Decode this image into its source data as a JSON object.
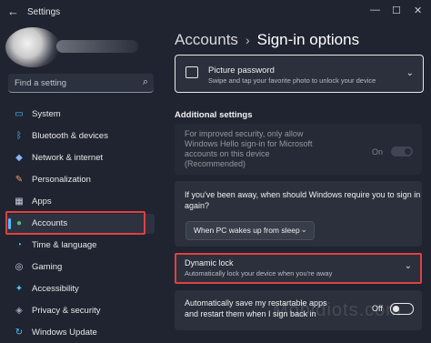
{
  "window": {
    "title": "Settings",
    "back_icon": "back-arrow-icon",
    "minimize_glyph": "—",
    "maximize_glyph": "☐",
    "close_glyph": "✕"
  },
  "search": {
    "placeholder": "Find a setting",
    "icon": "search-icon"
  },
  "sidebar": {
    "items": [
      {
        "label": "System",
        "icon": "monitor-icon",
        "color": "#4cc2ff"
      },
      {
        "label": "Bluetooth & devices",
        "icon": "bluetooth-icon",
        "color": "#4cc2ff"
      },
      {
        "label": "Network & internet",
        "icon": "wifi-icon",
        "color": "#8ab4f8"
      },
      {
        "label": "Personalization",
        "icon": "brush-icon",
        "color": "#f0a060"
      },
      {
        "label": "Apps",
        "icon": "apps-icon",
        "color": "#c8d0e0"
      },
      {
        "label": "Accounts",
        "icon": "person-icon",
        "color": "#4ec36c",
        "active": true
      },
      {
        "label": "Time & language",
        "icon": "globe-clock-icon",
        "color": "#4cc2ff"
      },
      {
        "label": "Gaming",
        "icon": "gamepad-icon",
        "color": "#c8d0e0"
      },
      {
        "label": "Accessibility",
        "icon": "accessibility-icon",
        "color": "#4cc2ff"
      },
      {
        "label": "Privacy & security",
        "icon": "shield-icon",
        "color": "#a0a8b8"
      },
      {
        "label": "Windows Update",
        "icon": "update-icon",
        "color": "#4cc2ff"
      }
    ]
  },
  "header": {
    "crumb": "Accounts",
    "separator": "›",
    "title": "Sign-in options"
  },
  "picture_password": {
    "title": "Picture password",
    "description": "Swipe and tap your favorite photo to unlock your device",
    "icon": "picture-icon"
  },
  "additional_settings": {
    "heading": "Additional settings",
    "hello_only": {
      "text_lines": [
        "For improved security, only allow",
        "Windows Hello sign-in for Microsoft",
        "accounts on this device",
        "(Recommended)"
      ],
      "state": "On"
    },
    "require_signin": {
      "question_lines": [
        "If you've been away, when should Windows require you to sign in",
        "again?"
      ],
      "selected": "When PC wakes up from sleep"
    },
    "dynamic_lock": {
      "title": "Dynamic lock",
      "description": "Automatically lock your device when you're away"
    },
    "restart_apps": {
      "text_lines": [
        "Automatically save my restartable apps",
        "and restart them when I sign back in"
      ],
      "state": "Off"
    }
  },
  "watermark": "Mobidiots.com",
  "colors": {
    "accent": "#4cc2ff",
    "highlight_red": "#e04040",
    "background": "#1f2430",
    "card": "#2b303c"
  }
}
